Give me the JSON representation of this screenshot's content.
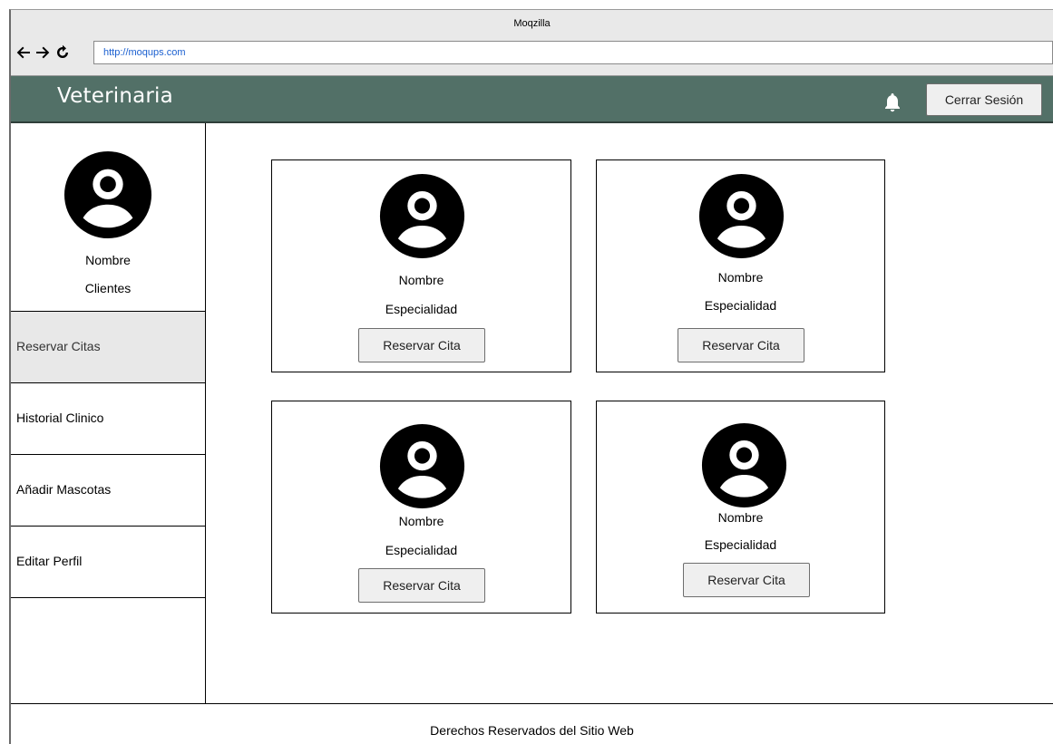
{
  "browser": {
    "title": "Moqzilla",
    "url": "http://moqups.com",
    "icons": [
      "back-arrow-icon",
      "forward-arrow-icon",
      "reload-icon"
    ]
  },
  "header": {
    "brand": "Veterinaria",
    "logout_label": "Cerrar Sesión",
    "bg_color": "#527067",
    "icon": "bell-icon"
  },
  "sidebar": {
    "profile_name": "Nombre",
    "profile_role": "Clientes",
    "items": [
      {
        "label": "Reservar Citas",
        "active": true
      },
      {
        "label": "Historial Clinico",
        "active": false
      },
      {
        "label": "Añadir Mascotas",
        "active": false
      },
      {
        "label": "Editar Perfil",
        "active": false
      }
    ]
  },
  "cards": [
    {
      "name": "Nombre",
      "specialty": "Especialidad",
      "button": "Reservar Cita"
    },
    {
      "name": "Nombre",
      "specialty": "Especialidad",
      "button": "Reservar Cita"
    },
    {
      "name": "Nombre",
      "specialty": "Especialidad",
      "button": "Reservar Cita"
    },
    {
      "name": "Nombre",
      "specialty": "Especialidad",
      "button": "Reservar Cita"
    }
  ],
  "footer": {
    "text": "Derechos Reservados del Sitio Web"
  }
}
